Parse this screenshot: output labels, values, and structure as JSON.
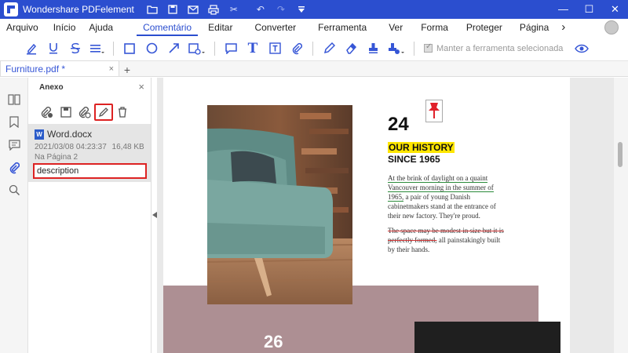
{
  "app": {
    "title": "Wondershare PDFelement",
    "titlebar_icons": [
      "folder-icon",
      "save-icon",
      "mail-icon",
      "print-icon",
      "scissors-icon",
      "undo-icon",
      "redo-icon",
      "dropdown-icon"
    ],
    "window_controls": [
      "minimize-icon",
      "maximize-icon",
      "close-icon"
    ]
  },
  "menu": {
    "items": [
      "Arquivo",
      "Início",
      "Ajuda",
      "Comentário",
      "Editar",
      "Converter",
      "Ferramenta",
      "Ver",
      "Forma",
      "Proteger",
      "Página"
    ],
    "active": "Comentário",
    "more": "›"
  },
  "toolbar": {
    "keep_tool_label": "Manter a ferramenta selecionada",
    "accent": "#3656d6"
  },
  "tabs": [
    {
      "label": "Furniture.pdf *",
      "close": "×"
    }
  ],
  "tab_add": "+",
  "panel": {
    "title": "Anexo",
    "close": "×",
    "attachment": {
      "name": "Word.docx",
      "date": "2021/03/08 04:23:37",
      "size": "16,48 KB",
      "page": "Na Página 2",
      "description": "description"
    }
  },
  "document": {
    "number_top": "24",
    "history_heading": "OUR HISTORY",
    "since": "SINCE 1965",
    "para1": {
      "underlined": "At the brink of daylight on a quaint Vancouver morning in the summer of 1965,",
      "rest": " a pair of young Danish cabinetmakers stand at the entrance of their new factory. They're proud."
    },
    "para2": {
      "strike": "The space may be modest in size but it is perfectly formed,",
      "rest": " all painstakingly built by their hands."
    },
    "number_bottom": "26",
    "colors": {
      "highlight": "#ffe600",
      "underline": "#2a8a3a",
      "strike": "#cc3333",
      "band": "#ad8f93"
    }
  }
}
